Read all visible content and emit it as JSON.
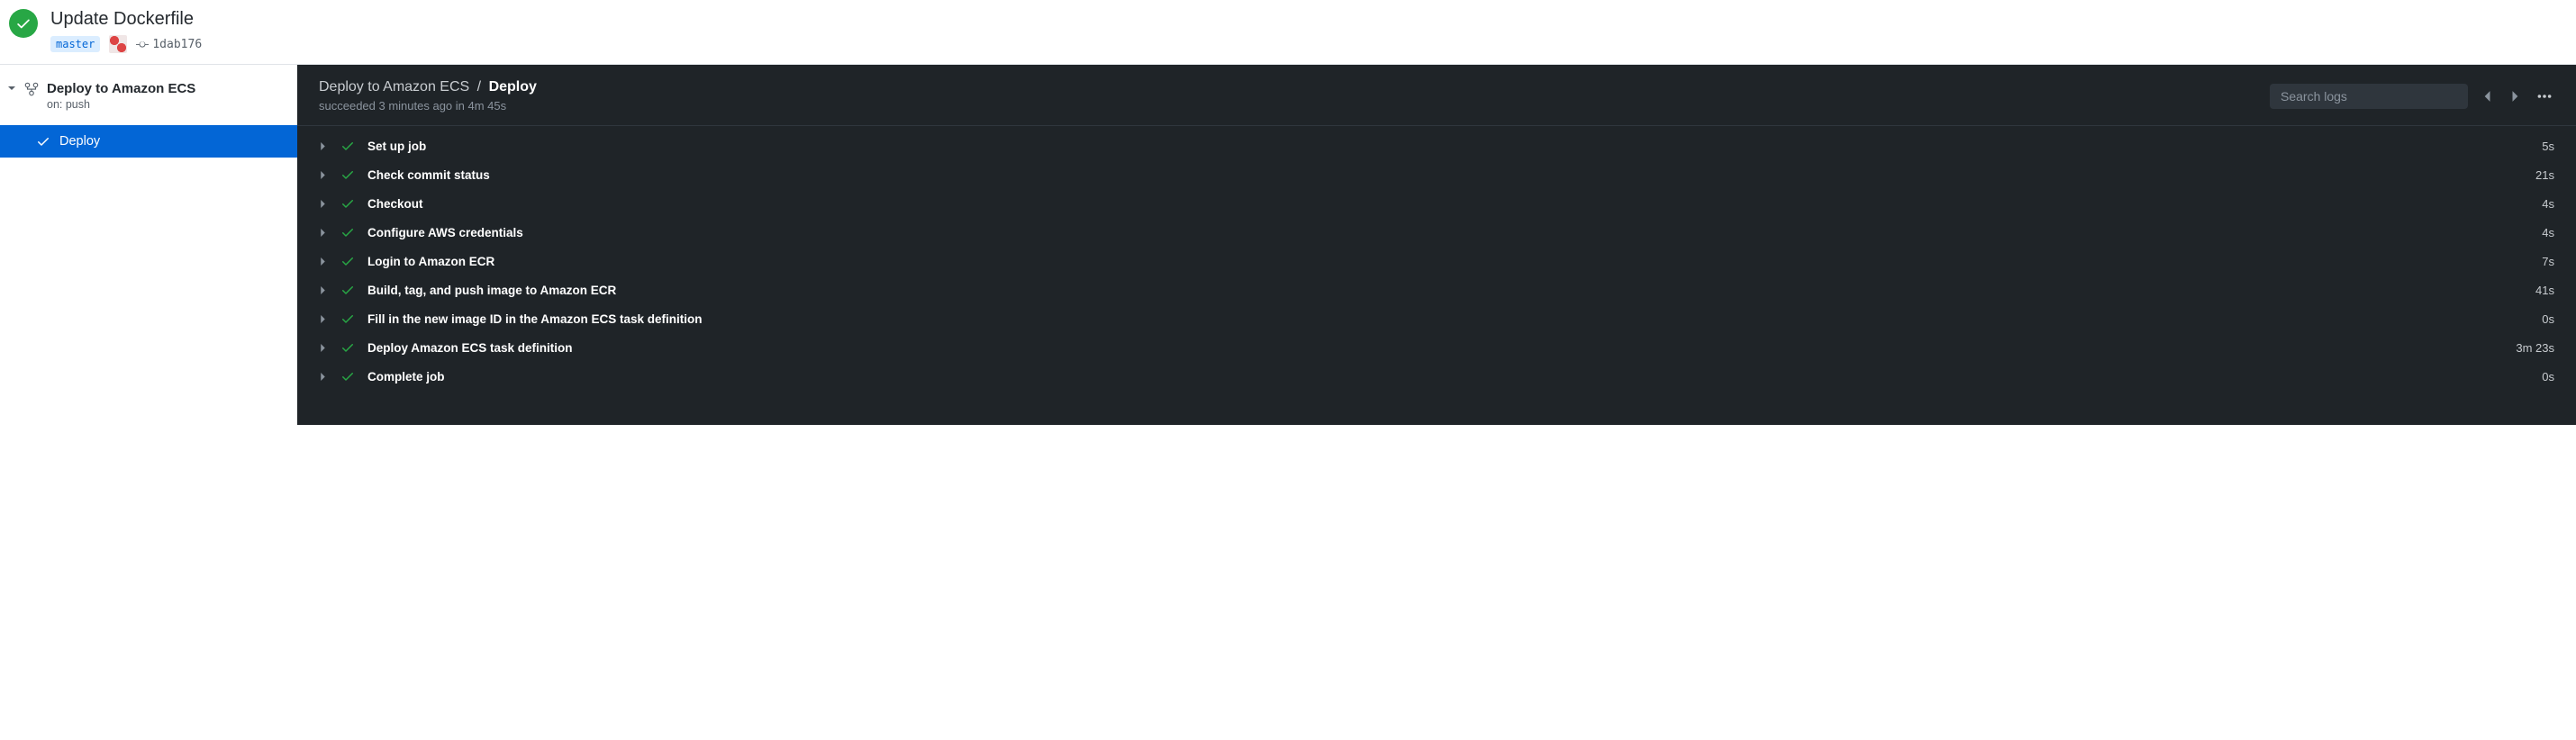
{
  "header": {
    "title": "Update Dockerfile",
    "branch": "master",
    "commit_sha": "1dab176"
  },
  "sidebar": {
    "workflow_name": "Deploy to Amazon ECS",
    "workflow_sub": "on: push",
    "job_name": "Deploy"
  },
  "main": {
    "breadcrumb_workflow": "Deploy to Amazon ECS",
    "breadcrumb_job": "Deploy",
    "status_line": "succeeded 3 minutes ago in 4m 45s",
    "search_placeholder": "Search logs"
  },
  "steps": [
    {
      "name": "Set up job",
      "duration": "5s"
    },
    {
      "name": "Check commit status",
      "duration": "21s"
    },
    {
      "name": "Checkout",
      "duration": "4s"
    },
    {
      "name": "Configure AWS credentials",
      "duration": "4s"
    },
    {
      "name": "Login to Amazon ECR",
      "duration": "7s"
    },
    {
      "name": "Build, tag, and push image to Amazon ECR",
      "duration": "41s"
    },
    {
      "name": "Fill in the new image ID in the Amazon ECS task definition",
      "duration": "0s"
    },
    {
      "name": "Deploy Amazon ECS task definition",
      "duration": "3m 23s"
    },
    {
      "name": "Complete job",
      "duration": "0s"
    }
  ]
}
